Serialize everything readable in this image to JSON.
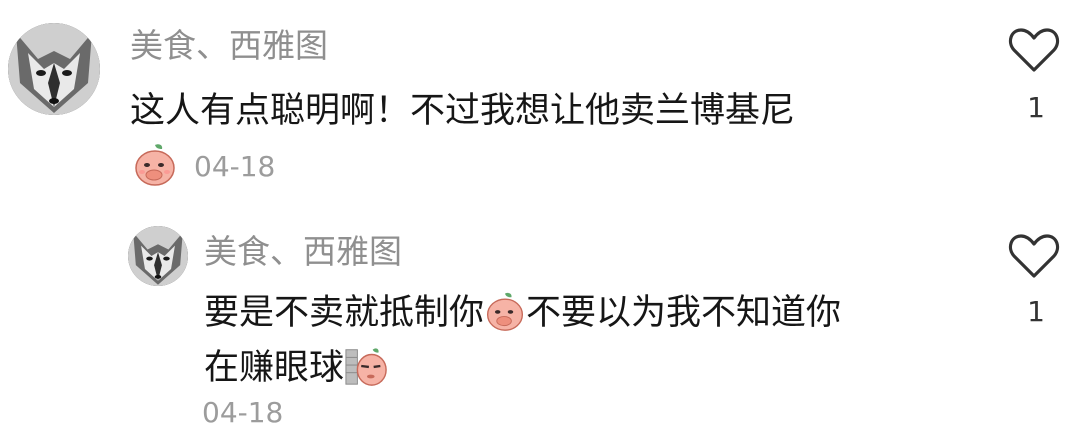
{
  "comments": [
    {
      "username": "美食、西雅图",
      "text": "这人有点聪明啊！不过我想让他卖兰博基尼",
      "date": "04-18",
      "likes": "1",
      "sticker": "peach-covering-mouth-sticker"
    },
    {
      "username": "美食、西雅图",
      "text_part1": "要是不卖就抵制你",
      "text_part2": "不要以为我不知道你",
      "text_line2": "在赚眼球",
      "date": "04-18",
      "likes": "1",
      "inline_emojis": [
        "peach-covering-mouth-emoji",
        "peach-peeking-wall-emoji"
      ]
    }
  ],
  "colors": {
    "username": "#8f8f8f",
    "text": "#161616",
    "date": "#9c9c9c",
    "heart_outline": "#333333",
    "peach": "#f6b3a6"
  }
}
